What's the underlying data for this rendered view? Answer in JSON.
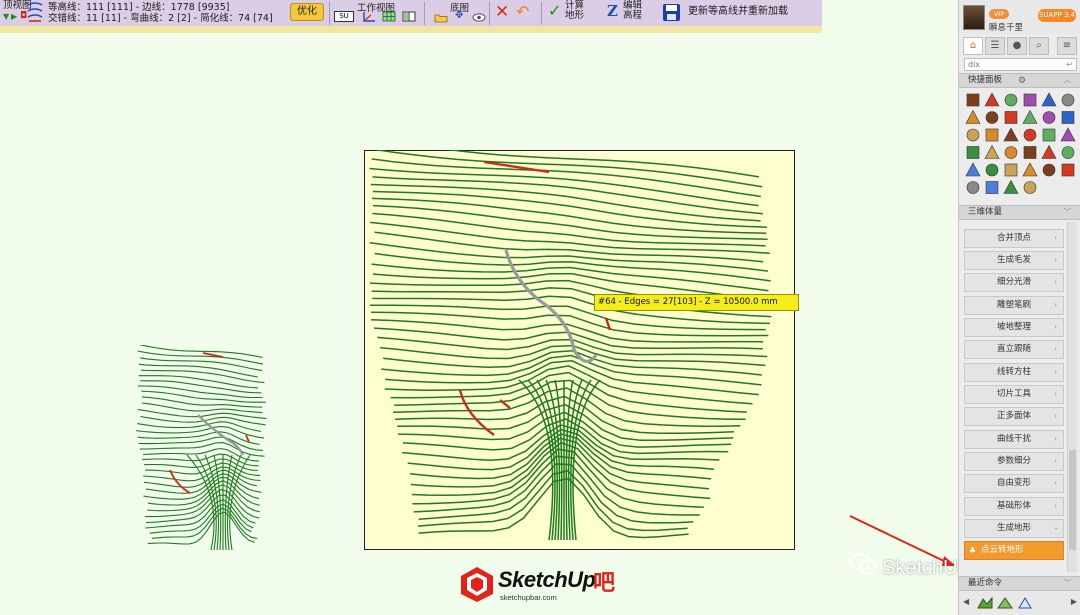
{
  "toolbar": {
    "view_label": "顶视图",
    "stats_line1": "等高线：111 [111] - 边线：1778 [9935]",
    "stats_line2": "交错线：11 [11] - 弯曲线：2 [2] - 简化线：74 [74]",
    "optimize_label": "优化",
    "work_view_label": "工作视图",
    "su_label": "SU",
    "base_map_label": "底图",
    "calc_terrain_line1": "计算",
    "calc_terrain_line2": "地形",
    "edit_elevation_line1": "编辑",
    "edit_elevation_line2": "高程",
    "reload_label": "更新等高线并重新加载",
    "accent_color": "#f5c83a",
    "background_color": "#dccde6"
  },
  "canvas": {
    "tooltip": "#64 - Edges = 27[103] - Z = 10500.0 mm",
    "contour_color": "#1e7a1e",
    "highlight_color": "#cc2a14",
    "selected_color": "#9a9a9a"
  },
  "logo": {
    "brand_text": "SketchUp",
    "brand_accent": "吧",
    "url": "sketchupbar.com"
  },
  "watermark": {
    "text": "SketchUp吧"
  },
  "panel": {
    "username": "瞬息千里",
    "vip_badge": "VIP",
    "app_badge": "SUAPP 3.4",
    "search_value": "dix",
    "search_enter_icon": "↵",
    "quick_panel_title": "快捷面板",
    "quick_panel_chevron": "︿",
    "section_3d_title": "三维体量",
    "section_3d_chevron": "﹀",
    "buttons": [
      {
        "label": "合并顶点"
      },
      {
        "label": "生成毛发"
      },
      {
        "label": "细分光滑"
      },
      {
        "label": "雕塑笔刷"
      },
      {
        "label": "坡地整理"
      },
      {
        "label": "直立跟随"
      },
      {
        "label": "线转方柱"
      },
      {
        "label": "切片工具"
      },
      {
        "label": "正多面体"
      },
      {
        "label": "曲线干扰"
      },
      {
        "label": "参数细分"
      },
      {
        "label": "自由变形"
      },
      {
        "label": "基础形体"
      },
      {
        "label": "生成地形"
      }
    ],
    "highlighted_button": "点云转地形",
    "recent_title": "最近命令",
    "recent_chevron": "﹀",
    "chevron_right": "›",
    "chevron_down": "›",
    "tabs": [
      "home-icon",
      "list-icon",
      "user-icon",
      "search-icon"
    ]
  }
}
